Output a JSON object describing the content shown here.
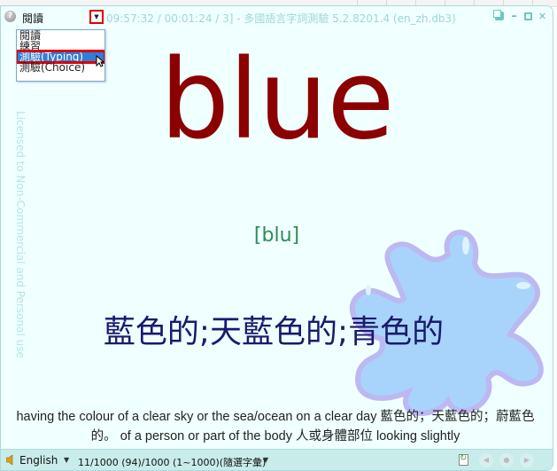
{
  "titlebar": {
    "mode_selected": "閱讀",
    "title": "09:57:32 / 00:01:24 / 3] - 多國語言字詞測驗 5.2.8201.4 (en_zh.db3)",
    "help_icon": "help-icon",
    "controls": [
      "restore-icon",
      "minimize-icon",
      "maximize-icon",
      "close-icon"
    ]
  },
  "dropdown": {
    "options": [
      "閱讀",
      "練習",
      "測驗(Typing)",
      "測驗(Choice)"
    ],
    "highlighted": "測驗(Typing)"
  },
  "watermark": "Licensed to Non-Commercial and Personal use",
  "card": {
    "word": "blue",
    "phonetic": "[blu]",
    "meaning": "藍色的;天藍色的;青色的",
    "definition": "having the colour of a clear sky or the sea/ocean on a clear day 藍色的；天藍色的；蔚藍色的。 of a person or part of the body 人或身體部位 looking slightly"
  },
  "statusbar": {
    "language": "English",
    "progress": "11/1000 (94)/1000 (1~1000)(隨選字彙)",
    "icons": [
      "speaker-icon",
      "refresh-icon",
      "prev-icon",
      "stop-icon",
      "next-icon"
    ]
  },
  "colors": {
    "word": "#8b0000",
    "phonetic": "#2e8b57",
    "meaning": "#1a1a6e",
    "background": "#f0ffff",
    "highlight_box": "#e00000",
    "selection": "#2f7fd9"
  }
}
